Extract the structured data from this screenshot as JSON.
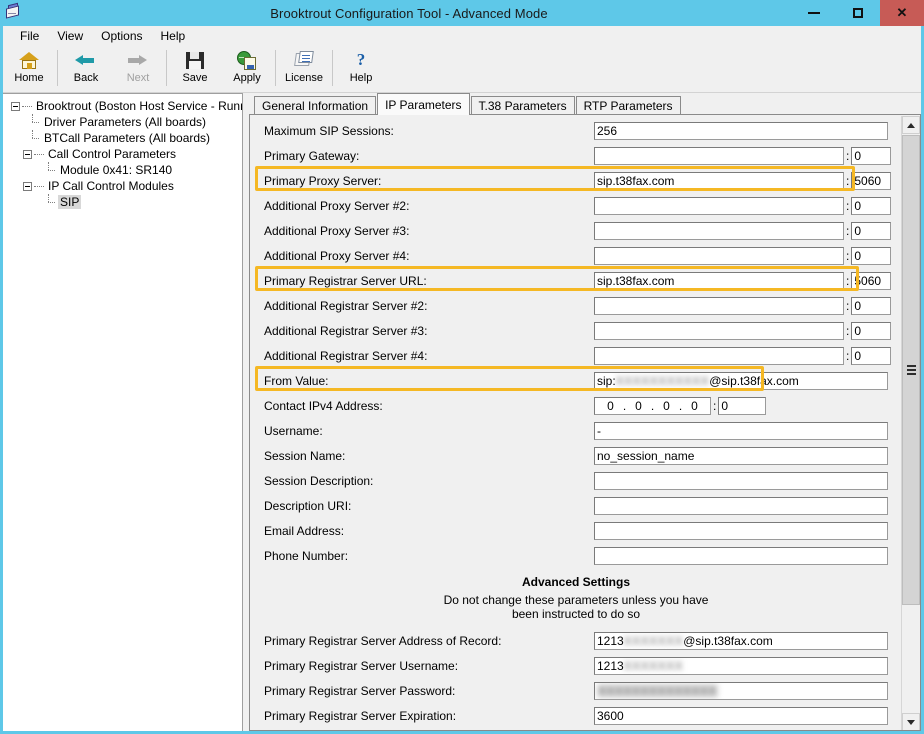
{
  "window": {
    "title": "Brooktrout Configuration Tool - Advanced Mode",
    "app_icon": "fax-machine-icon",
    "titlebar_color": "#5ec8e8",
    "minimize_label": "Minimize",
    "maximize_label": "Maximize",
    "close_label": "✕"
  },
  "menubar": {
    "items": [
      {
        "label": "File"
      },
      {
        "label": "View"
      },
      {
        "label": "Options"
      },
      {
        "label": "Help"
      }
    ]
  },
  "toolbar": {
    "buttons": [
      {
        "label": "Home",
        "icon": "home-icon",
        "disabled": false
      },
      {
        "label": "Back",
        "icon": "back-arrow-icon",
        "disabled": false
      },
      {
        "label": "Next",
        "icon": "next-arrow-icon",
        "disabled": true
      },
      {
        "label": "Save",
        "icon": "floppy-disk-icon",
        "disabled": false
      },
      {
        "label": "Apply",
        "icon": "apply-globe-icon",
        "disabled": false
      },
      {
        "label": "License",
        "icon": "license-document-icon",
        "disabled": false
      },
      {
        "label": "Help",
        "icon": "question-mark-icon",
        "disabled": false
      }
    ]
  },
  "tree": {
    "nodes": [
      {
        "label": "Brooktrout (Boston Host Service - Running)",
        "level": 0,
        "expander": "minus",
        "selected": false
      },
      {
        "label": "Driver Parameters (All boards)",
        "level": 1,
        "expander": "none",
        "selected": false
      },
      {
        "label": "BTCall Parameters (All boards)",
        "level": 1,
        "expander": "none",
        "selected": false
      },
      {
        "label": "Call Control Parameters",
        "level": 1,
        "expander": "minus",
        "selected": false
      },
      {
        "label": "Module 0x41: SR140",
        "level": 2,
        "expander": "none",
        "selected": false
      },
      {
        "label": "IP Call Control Modules",
        "level": 1,
        "expander": "minus",
        "selected": false
      },
      {
        "label": "SIP",
        "level": 2,
        "expander": "none",
        "selected": true
      }
    ]
  },
  "tabs": [
    {
      "label": "General Information",
      "active": false
    },
    {
      "label": "IP Parameters",
      "active": true
    },
    {
      "label": "T.38 Parameters",
      "active": false
    },
    {
      "label": "RTP Parameters",
      "active": false
    }
  ],
  "form": {
    "highlight_color": "#f5b824",
    "rows": [
      {
        "label": "Maximum SIP Sessions:",
        "type": "text",
        "value": "256",
        "highlighted": false
      },
      {
        "label": "Primary Gateway:",
        "type": "hostport",
        "value": "",
        "port": "0",
        "highlighted": false
      },
      {
        "label": "Primary Proxy Server:",
        "type": "hostport",
        "value": "sip.t38fax.com",
        "port": "5060",
        "highlighted": true
      },
      {
        "label": "Additional Proxy Server #2:",
        "type": "hostport",
        "value": "",
        "port": "0",
        "highlighted": false
      },
      {
        "label": "Additional Proxy Server #3:",
        "type": "hostport",
        "value": "",
        "port": "0",
        "highlighted": false
      },
      {
        "label": "Additional Proxy Server #4:",
        "type": "hostport",
        "value": "",
        "port": "0",
        "highlighted": false
      },
      {
        "label": "Primary Registrar Server URL:",
        "type": "hostport",
        "value": "sip.t38fax.com",
        "port": "5060",
        "highlighted": true
      },
      {
        "label": "Additional Registrar Server #2:",
        "type": "hostport",
        "value": "",
        "port": "0",
        "highlighted": false
      },
      {
        "label": "Additional Registrar Server #3:",
        "type": "hostport",
        "value": "",
        "port": "0",
        "highlighted": false
      },
      {
        "label": "Additional Registrar Server #4:",
        "type": "hostport",
        "value": "",
        "port": "0",
        "highlighted": false
      },
      {
        "label": "From Value:",
        "type": "redacted",
        "prefix": "sip:",
        "redacted": "XXXXXXXXXXX",
        "suffix": "@sip.t38fax.com",
        "highlighted": true
      },
      {
        "label": "Contact IPv4 Address:",
        "type": "ip",
        "octets": [
          "0",
          "0",
          "0",
          "0"
        ],
        "port": "0",
        "highlighted": false
      },
      {
        "label": "Username:",
        "type": "text",
        "value": "-",
        "highlighted": false
      },
      {
        "label": "Session Name:",
        "type": "text",
        "value": "no_session_name",
        "highlighted": false
      },
      {
        "label": "Session Description:",
        "type": "text",
        "value": "",
        "highlighted": false
      },
      {
        "label": "Description URI:",
        "type": "text",
        "value": "",
        "highlighted": false
      },
      {
        "label": "Email Address:",
        "type": "text",
        "value": "",
        "highlighted": false
      },
      {
        "label": "Phone Number:",
        "type": "text",
        "value": "",
        "highlighted": false
      }
    ],
    "advanced": {
      "title": "Advanced Settings",
      "subtitle_line1": "Do not change these parameters unless you have",
      "subtitle_line2": "been instructed to do so",
      "rows": [
        {
          "label": "Primary Registrar Server Address of Record:",
          "type": "redacted",
          "prefix": "1213",
          "redacted": "XXXXXXX",
          "suffix": "@sip.t38fax.com"
        },
        {
          "label": "Primary Registrar Server Username:",
          "type": "redacted",
          "prefix": "1213",
          "redacted": "XXXXXXX",
          "suffix": ""
        },
        {
          "label": "Primary Registrar Server Password:",
          "type": "password",
          "masked": "XXXXXXXXXXXXXX"
        },
        {
          "label": "Primary Registrar Server Expiration:",
          "type": "text",
          "value": "3600"
        }
      ]
    }
  },
  "scrollbar": {
    "up_arrow": "caret-up-icon",
    "down_arrow": "caret-down-icon",
    "thumb": "scroll-thumb"
  }
}
